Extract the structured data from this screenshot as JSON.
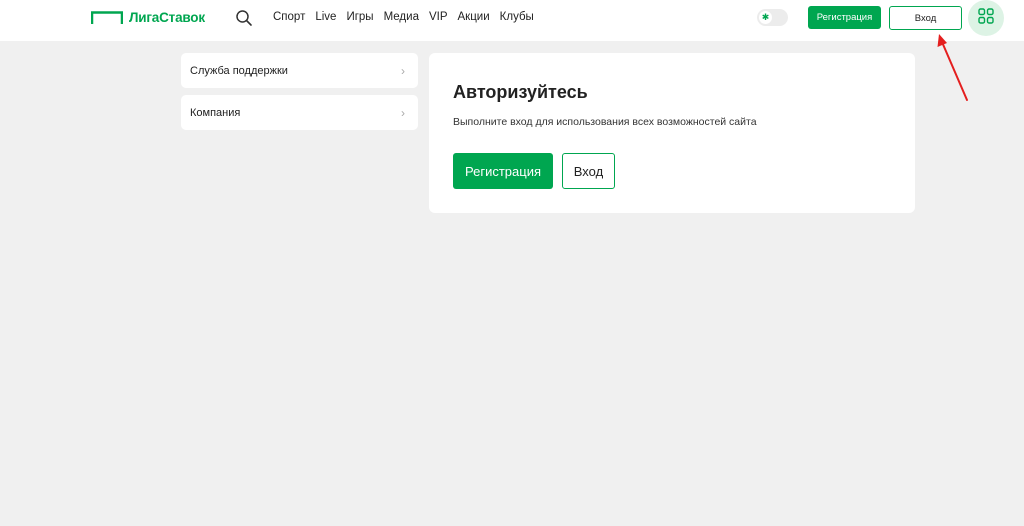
{
  "header": {
    "logo_text": "ЛигаСтавок",
    "nav": [
      "Спорт",
      "Live",
      "Игры",
      "Медиа",
      "VIP",
      "Акции",
      "Клубы"
    ],
    "register_label": "Регистрация",
    "login_label": "Вход"
  },
  "sidebar": {
    "items": [
      {
        "label": "Служба поддержки"
      },
      {
        "label": "Компания"
      }
    ]
  },
  "main": {
    "title": "Авторизуйтесь",
    "description": "Выполните вход для использования всех возможностей сайта",
    "register_label": "Регистрация",
    "login_label": "Вход"
  },
  "colors": {
    "brand_green": "#00a650",
    "background": "#f0f0f0",
    "annotation_red": "#e41f1f"
  },
  "icons": {
    "search": "search-icon",
    "theme": "sun-icon",
    "apps": "grid-icon",
    "chevron": "chevron-right-icon"
  }
}
